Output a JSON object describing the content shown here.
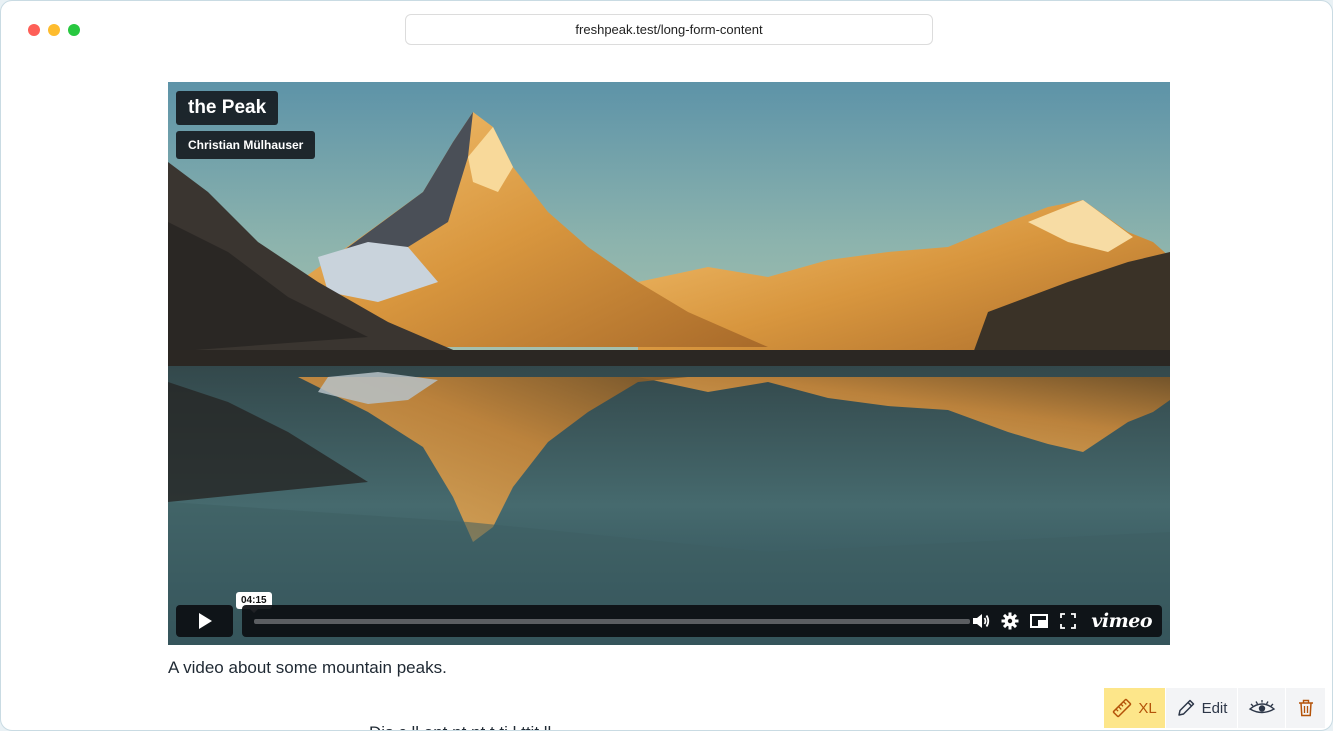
{
  "browser": {
    "url": "freshpeak.test/long-form-content"
  },
  "video": {
    "title": "the Peak",
    "author": "Christian Mülhauser",
    "time_display": "04:15",
    "progress": 0,
    "provider_logo": "vimeo",
    "icons": [
      "play-icon",
      "volume-icon",
      "settings-icon",
      "picture-in-picture-icon",
      "fullscreen-icon"
    ]
  },
  "caption": "A video about some mountain peaks.",
  "partial_text": "Dis   c   ll      ent     nt  nt t   ti    l       ttit      ll",
  "toolbar": {
    "size_label": "XL",
    "edit_label": "Edit",
    "icons": [
      "ruler-icon",
      "pencil-icon",
      "eye-icon",
      "trash-icon"
    ],
    "accent_color": "#fde68a",
    "accent_text_color": "#b45309"
  }
}
